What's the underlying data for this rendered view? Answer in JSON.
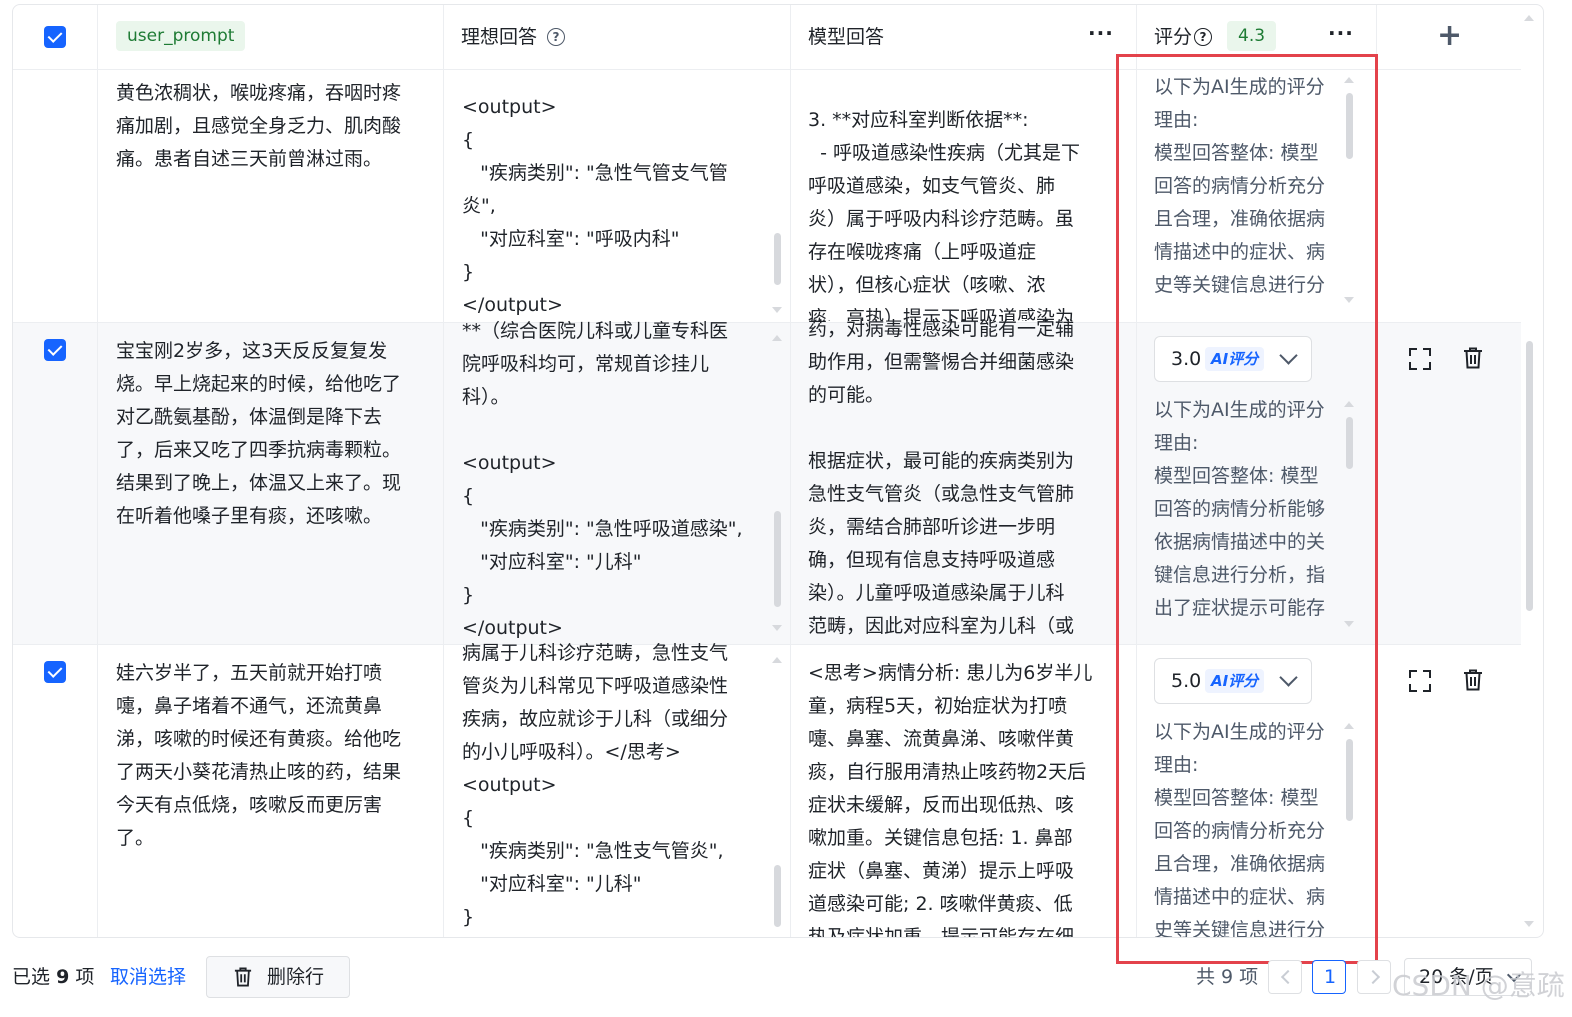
{
  "header": {
    "user_prompt_tag": "user_prompt",
    "ideal_answer": "理想回答",
    "model_answer": "模型回答",
    "score": "评分",
    "score_avg": "4.3"
  },
  "rows": [
    {
      "user_prompt": "黄色浓稠状，喉咙疼痛，吞咽时疼\n痛加剧，且感觉全身乏力、肌肉酸\n痛。患者自述三天前曾淋过雨。",
      "ideal_answer": "<output>\n{\n   \"疾病类别\": \"急性气管支气管\n炎\",\n   \"对应科室\": \"呼吸内科\"\n}\n</output>",
      "model_answer": "3. **对应科室判断依据**:\n  - 呼吸道感染性疾病（尤其是下\n呼吸道感染，如支气管炎、肺\n炎）属于呼吸内科诊疗范畴。虽\n存在喉咙疼痛（上呼吸道症\n状），但核心症状（咳嗽、浓\n痰、高热）提示下呼吸道感染为",
      "score_reason": "以下为AI生成的评分\n理由:\n模型回答整体: 模型\n回答的病情分析充分\n且合理，准确依据病\n情描述中的症状、病\n史等关键信息进行分"
    },
    {
      "user_prompt": "宝宝刚2岁多，这3天反反复复发\n烧。早上烧起来的时候，给他吃了\n对乙酰氨基酚，体温倒是降下去\n了，后来又吃了四季抗病毒颗粒。\n结果到了晚上，体温又上来了。现\n在听着他嗓子里有痰，还咳嗽。",
      "ideal_answer": "**（综合医院儿科或儿童专科医\n院呼吸科均可，常规首诊挂儿\n科）。\n\n<output>\n{\n   \"疾病类别\": \"急性呼吸道感染\",\n   \"对应科室\": \"儿科\"\n}\n</output>",
      "model_answer": "药，对病毒性感染可能有一定辅\n助作用，但需警惕合并细菌感染\n的可能。\n\n根据症状，最可能的疾病类别为\n急性支气管炎（或急性支气管肺\n炎，需结合肺部听诊进一步明\n确，但现有信息支持呼吸道感\n染）。儿童呼吸道感染属于儿科\n范畴，因此对应科室为儿科（或",
      "score_value": "3.0",
      "ai_badge": "AI评分",
      "score_reason": "以下为AI生成的评分\n理由:\n模型回答整体: 模型\n回答的病情分析能够\n依据病情描述中的关\n键信息进行分析，指\n出了症状提示可能存"
    },
    {
      "user_prompt": "娃六岁半了，五天前就开始打喷\n嚏，鼻子堵着不通气，还流黄鼻\n涕，咳嗽的时候还有黄痰。给他吃\n了两天小葵花清热止咳的药，结果\n今天有点低烧，咳嗽反而更厉害\n了。",
      "ideal_answer": "病属于儿科诊疗范畴，急性支气\n管炎为儿科常见下呼吸道感染性\n疾病，故应就诊于儿科（或细分\n的小儿呼吸科）。</思考>\n<output>\n{\n   \"疾病类别\": \"急性支气管炎\",\n   \"对应科室\": \"儿科\"\n}",
      "model_answer": "<思考>病情分析: 患儿为6岁半儿\n童，病程5天，初始症状为打喷\n嚏、鼻塞、流黄鼻涕、咳嗽伴黄\n痰，自行服用清热止咳药物2天后\n症状未缓解，反而出现低热、咳\n嗽加重。关键信息包括: 1. 鼻部\n症状（鼻塞、黄涕）提示上呼吸\n道感染可能; 2. 咳嗽伴黄痰、低\n热及症状加重，提示可能存在细",
      "score_value": "5.0",
      "ai_badge": "AI评分",
      "score_reason": "以下为AI生成的评分\n理由:\n模型回答整体: 模型\n回答的病情分析充分\n且合理，准确依据病\n情描述中的症状、病\n史等关键信息进行分"
    }
  ],
  "footer": {
    "selected_prefix": "已选",
    "selected_count": "9",
    "selected_suffix": "项",
    "cancel_select": "取消选择",
    "delete_rows": "删除行",
    "total": "共 9 项",
    "page": "1",
    "page_size": "20 条/页"
  },
  "watermark": "CSDN @意疏",
  "colors": {
    "accent": "#1664ff",
    "tag_bg": "#eaf6ec",
    "tag_text": "#1e7b34",
    "highlight_box": "#e3424b",
    "row_alt_bg": "#f7f8fa"
  },
  "icons": [
    "checkbox-checked-icon",
    "help-circle-icon",
    "more-horizontal-icon",
    "plus-icon",
    "chevron-down-icon",
    "fullscreen-icon",
    "trash-icon",
    "chevron-left-icon",
    "chevron-right-icon"
  ]
}
